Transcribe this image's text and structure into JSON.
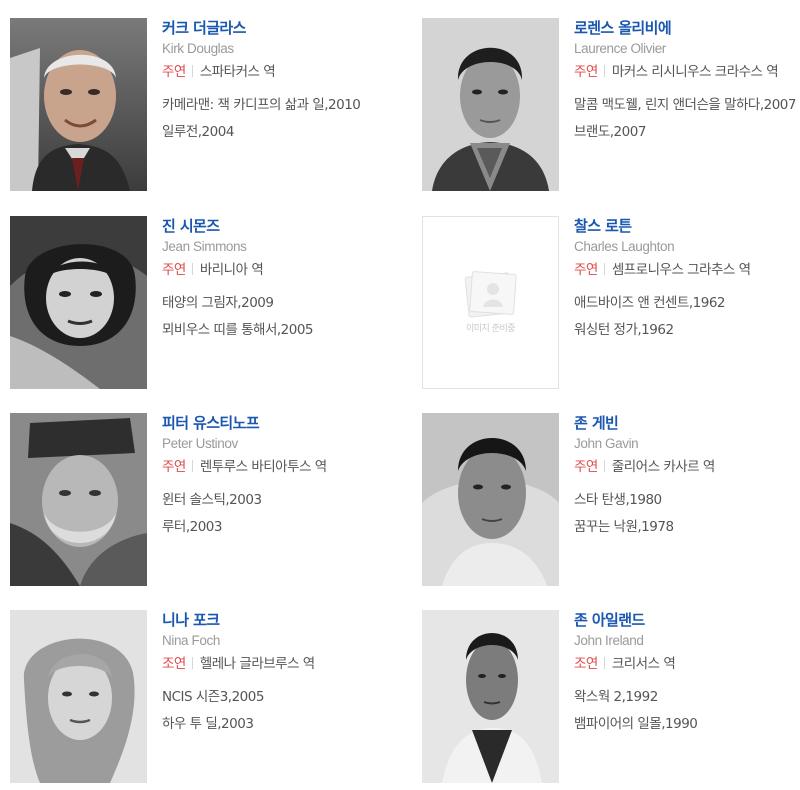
{
  "cast": [
    {
      "name": "커크 더글라스",
      "name_en": "Kirk Douglas",
      "role_type": "주연",
      "role": "스파타커스 역",
      "works": [
        "카메라맨: 잭 카디프의 삶과 일,2010",
        "일루전,2004"
      ]
    },
    {
      "name": "로렌스 올리비에",
      "name_en": "Laurence Olivier",
      "role_type": "주연",
      "role": "마커스 리시니우스 크라수스 역",
      "works": [
        "말콤 맥도웰, 린지 앤더슨을 말하다,2007",
        "브랜도,2007"
      ]
    },
    {
      "name": "진 시몬즈",
      "name_en": "Jean Simmons",
      "role_type": "주연",
      "role": "바리니아 역",
      "works": [
        "태양의 그림자,2009",
        "뫼비우스 띠를 통해서,2005"
      ]
    },
    {
      "name": "찰스 로튼",
      "name_en": "Charles Laughton",
      "role_type": "주연",
      "role": "셈프로니우스 그라추스 역",
      "works": [
        "애드바이즈 앤 컨센트,1962",
        "워싱턴 정가,1962"
      ],
      "placeholder_text": "이미지 준비중"
    },
    {
      "name": "피터 유스티노프",
      "name_en": "Peter Ustinov",
      "role_type": "주연",
      "role": "렌투루스 바티아투스 역",
      "works": [
        "윈터 솔스틱,2003",
        "루터,2003"
      ]
    },
    {
      "name": "존 게빈",
      "name_en": "John Gavin",
      "role_type": "주연",
      "role": "줄리어스 카사르 역",
      "works": [
        "스타 탄생,1980",
        "꿈꾸는 낙원,1978"
      ]
    },
    {
      "name": "니나 포크",
      "name_en": "Nina Foch",
      "role_type": "조연",
      "role": "헬레나 글라브루스 역",
      "works": [
        "NCIS 시즌3,2005",
        "하우 투 딜,2003"
      ]
    },
    {
      "name": "존 아일랜드",
      "name_en": "John Ireland",
      "role_type": "조연",
      "role": "크리서스 역",
      "works": [
        "왁스웍 2,1992",
        "뱀파이어의 일몰,1990"
      ]
    }
  ]
}
